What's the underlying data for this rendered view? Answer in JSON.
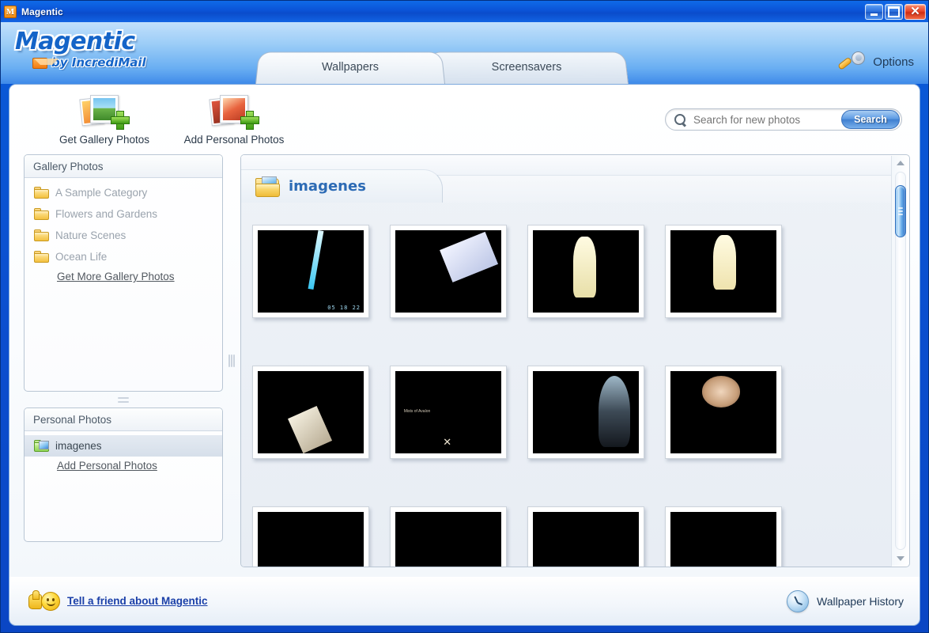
{
  "window": {
    "title": "Magentic",
    "app_icon": "M",
    "controls": {
      "minimize": "minimize-button",
      "maximize": "maximize-button",
      "close": "✕"
    }
  },
  "branding": {
    "logo_main": "Magentic",
    "logo_by": "by",
    "logo_brand": "IncrediMail",
    "logo_sub": "by IncrediMail",
    "colors": {
      "logo_blue": "#1464c8",
      "titlebar_blue": "#0b52d6",
      "accent": "#2d6bb5"
    }
  },
  "tabs": [
    {
      "label": "Wallpapers",
      "active": true
    },
    {
      "label": "Screensavers",
      "active": false
    }
  ],
  "options": {
    "label": "Options",
    "icon": "wrench-icon"
  },
  "toolbar": {
    "buttons": [
      {
        "label": "Get Gallery Photos",
        "icon": "gallery-photos-icon"
      },
      {
        "label": "Add Personal Photos",
        "icon": "personal-photos-icon"
      }
    ]
  },
  "search": {
    "placeholder": "Search for new photos",
    "value": "",
    "button_label": "Search",
    "icon": "search-icon"
  },
  "sidebar": {
    "gallery": {
      "header": "Gallery Photos",
      "items": [
        {
          "label": "A Sample Category",
          "icon": "folder-icon"
        },
        {
          "label": "Flowers and Gardens",
          "icon": "folder-icon"
        },
        {
          "label": "Nature Scenes",
          "icon": "folder-icon"
        },
        {
          "label": "Ocean Life",
          "icon": "folder-icon"
        }
      ],
      "link": "Get More Gallery Photos"
    },
    "personal": {
      "header": "Personal Photos",
      "items": [
        {
          "label": "imagenes",
          "icon": "folder-green-icon",
          "selected": true
        }
      ],
      "link": "Add Personal Photos"
    }
  },
  "content": {
    "folder_name": "imagenes",
    "folder_icon": "open-folder-photo-icon",
    "thumbnails": [
      {
        "name": "space-vortex-photo",
        "art": "art-space",
        "letterbox": false,
        "timestamp": "05 18 22"
      },
      {
        "name": "woman-sleeping-photo",
        "art": "art-sleep",
        "letterbox": false
      },
      {
        "name": "surfer-with-board-photo",
        "art": "art-surf1",
        "letterbox": true
      },
      {
        "name": "surfer-stretching-photo",
        "art": "art-surf2",
        "letterbox": true
      },
      {
        "name": "sunset-beach-surfer-photo",
        "art": "art-sunset",
        "letterbox": true
      },
      {
        "name": "dark-silhouette-photo",
        "art": "art-dark",
        "letterbox": false,
        "caption": "Mists of Avalon"
      },
      {
        "name": "alien-figure-photo",
        "art": "art-alien",
        "letterbox": false
      },
      {
        "name": "woman-green-dress-photo",
        "art": "art-green",
        "letterbox": true
      },
      {
        "name": "wooden-interior-photo",
        "art": "art-wood",
        "letterbox": false
      },
      {
        "name": "green-foliage-photo",
        "art": "art-leaf",
        "letterbox": false
      },
      {
        "name": "night-scene-photo",
        "art": "art-night",
        "letterbox": false
      },
      {
        "name": "blue-portrait-photo",
        "art": "art-blue",
        "letterbox": true
      }
    ]
  },
  "scrollbar": {
    "up_arrow": "▲",
    "down_arrow": "▼",
    "thumb_position_percent": 4
  },
  "statusbar": {
    "tell_a_friend": "Tell a friend about Magentic",
    "tell_icon": "thumbs-up-smiley-icon",
    "wallpaper_history": "Wallpaper History",
    "history_icon": "clock-icon"
  }
}
